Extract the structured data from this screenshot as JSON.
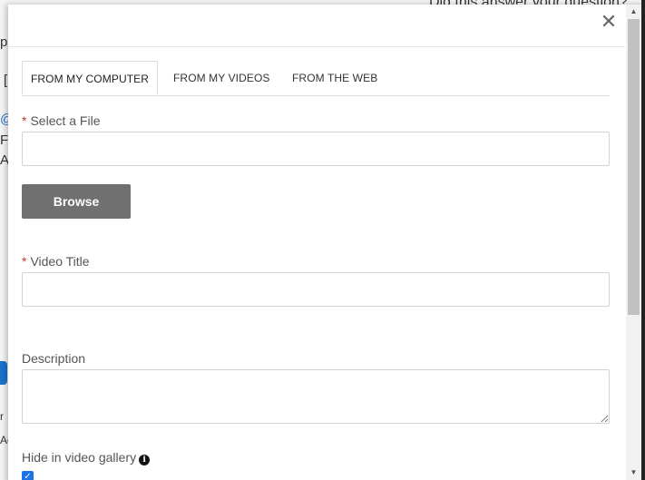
{
  "background": {
    "top_text": "Did this answer your question?",
    "frag_p": "p",
    "frag_l": "[",
    "frag_at": "@",
    "frag_fr": "Fr",
    "frag_at2": "At",
    "frag_r": "r",
    "frag_ac": "Ac"
  },
  "modal": {
    "close_label": "✕",
    "tabs": [
      {
        "label": "FROM MY COMPUTER",
        "active": true
      },
      {
        "label": "FROM MY VIDEOS",
        "active": false
      },
      {
        "label": "FROM THE WEB",
        "active": false
      }
    ],
    "file_field": {
      "required_mark": "*",
      "label": "Select a File",
      "value": "",
      "placeholder": ""
    },
    "browse_label": "Browse",
    "title_field": {
      "required_mark": "*",
      "label": "Video Title",
      "value": "",
      "placeholder": ""
    },
    "description_field": {
      "label": "Description",
      "value": "",
      "placeholder": ""
    },
    "hide_gallery": {
      "label": "Hide in video gallery",
      "info_icon": "i",
      "checked": true,
      "check_glyph": "✓"
    }
  },
  "scrollbar": {
    "up_glyph": "▲",
    "down_glyph": "▼"
  }
}
